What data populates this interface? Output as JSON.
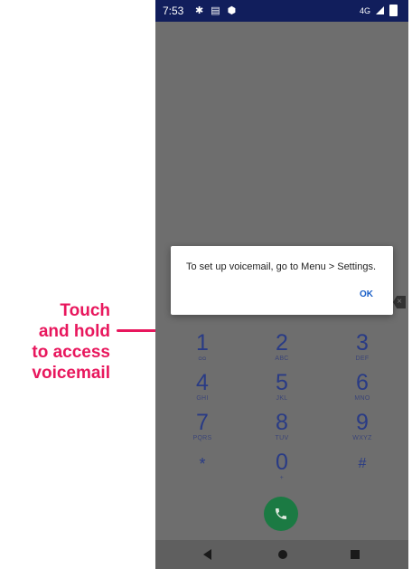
{
  "annotation": {
    "lines": [
      "Touch",
      "and hold",
      "to access",
      "voicemail"
    ]
  },
  "status_bar": {
    "time": "7:53",
    "network": "4G",
    "icons": [
      "settings-icon",
      "message-icon",
      "shield-icon",
      "signal-icon",
      "battery-icon"
    ]
  },
  "dialog": {
    "message": "To set up voicemail, go to Menu > Settings.",
    "ok_label": "OK"
  },
  "dialpad": {
    "keys": [
      {
        "digit": "1",
        "letters": "ᴑᴑ"
      },
      {
        "digit": "2",
        "letters": "ABC"
      },
      {
        "digit": "3",
        "letters": "DEF"
      },
      {
        "digit": "4",
        "letters": "GHI"
      },
      {
        "digit": "5",
        "letters": "JKL"
      },
      {
        "digit": "6",
        "letters": "MNO"
      },
      {
        "digit": "7",
        "letters": "PQRS"
      },
      {
        "digit": "8",
        "letters": "TUV"
      },
      {
        "digit": "9",
        "letters": "WXYZ"
      },
      {
        "digit": "*",
        "letters": ""
      },
      {
        "digit": "0",
        "letters": "+"
      },
      {
        "digit": "#",
        "letters": ""
      }
    ]
  },
  "colors": {
    "annotation": "#e8175d",
    "status_bar": "#111e5c",
    "call_button": "#1b7a43",
    "dialog_action": "#1a5fc8"
  }
}
